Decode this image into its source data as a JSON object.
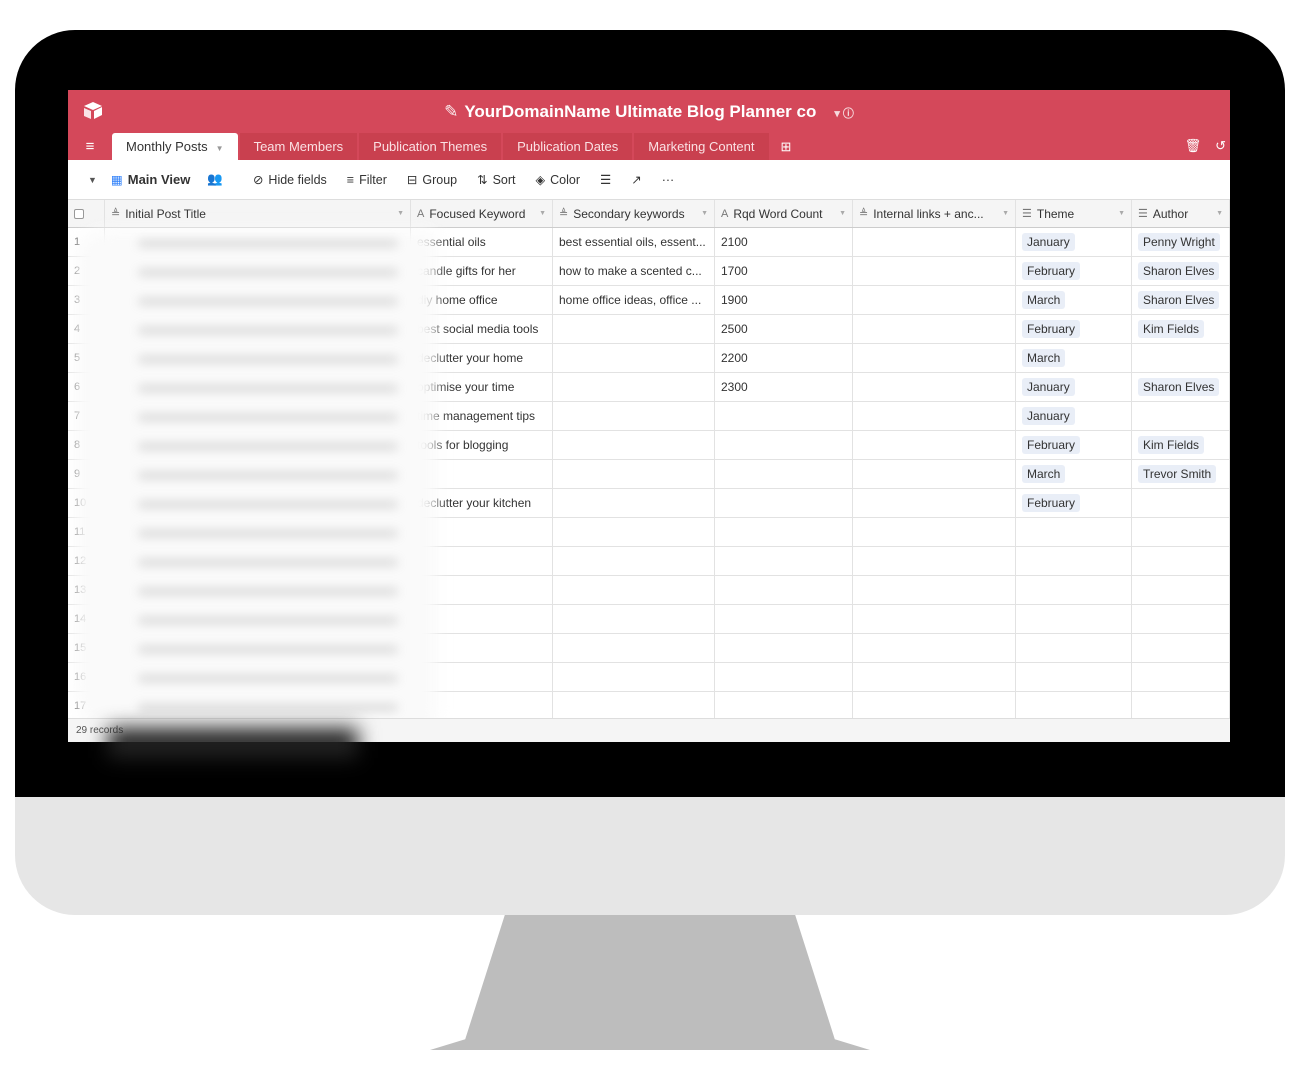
{
  "app": {
    "title": "YourDomainName Ultimate Blog Planner co",
    "accent": "#d4485a"
  },
  "tabs": [
    {
      "label": "Monthly Posts",
      "active": true
    },
    {
      "label": "Team Members"
    },
    {
      "label": "Publication Themes"
    },
    {
      "label": "Publication Dates"
    },
    {
      "label": "Marketing Content"
    }
  ],
  "toolbar": {
    "view": "Main View",
    "hide_fields": "Hide fields",
    "filter": "Filter",
    "group": "Group",
    "sort": "Sort",
    "color": "Color",
    "more": "···"
  },
  "columns": [
    "Initial Post Title",
    "Focused Keyword",
    "Secondary keywords",
    "Rqd Word Count",
    "Internal links + anc...",
    "Theme",
    "Author"
  ],
  "rows": [
    {
      "n": "1",
      "kw": "essential oils",
      "sec": "best essential oils, essent...",
      "wc": "2100",
      "theme": "January",
      "author": "Penny Wright"
    },
    {
      "n": "2",
      "kw": "candle gifts for her",
      "sec": "how to make a scented c...",
      "wc": "1700",
      "theme": "February",
      "author": "Sharon Elves"
    },
    {
      "n": "3",
      "kw": "diy home office",
      "sec": "home office ideas, office ...",
      "wc": "1900",
      "theme": "March",
      "author": "Sharon Elves"
    },
    {
      "n": "4",
      "kw": "best social media tools",
      "sec": "",
      "wc": "2500",
      "theme": "February",
      "author": "Kim Fields"
    },
    {
      "n": "5",
      "kw": "declutter your home",
      "sec": "",
      "wc": "2200",
      "theme": "March",
      "author": ""
    },
    {
      "n": "6",
      "kw": "optimise your time",
      "sec": "",
      "wc": "2300",
      "theme": "January",
      "author": "Sharon Elves"
    },
    {
      "n": "7",
      "kw": "time management tips",
      "sec": "",
      "wc": "",
      "theme": "January",
      "author": ""
    },
    {
      "n": "8",
      "kw": "tools for blogging",
      "sec": "",
      "wc": "",
      "theme": "February",
      "author": "Kim Fields"
    },
    {
      "n": "9",
      "kw": "",
      "sec": "",
      "wc": "",
      "theme": "March",
      "author": "Trevor Smith"
    },
    {
      "n": "10",
      "kw": "declutter your kitchen",
      "sec": "",
      "wc": "",
      "theme": "February",
      "author": ""
    },
    {
      "n": "11"
    },
    {
      "n": "12"
    },
    {
      "n": "13"
    },
    {
      "n": "14"
    },
    {
      "n": "15"
    },
    {
      "n": "16"
    },
    {
      "n": "17"
    }
  ],
  "footer": {
    "records": "29 records"
  }
}
